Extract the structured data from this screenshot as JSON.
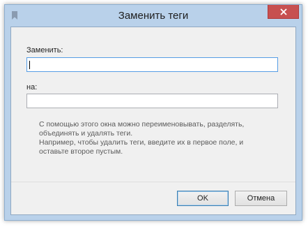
{
  "window": {
    "title": "Заменить теги",
    "close_symbol": "✕",
    "icon": "bookmark-icon"
  },
  "form": {
    "replace_label": "Заменить:",
    "replace_value": "",
    "with_label": "на:",
    "with_value": ""
  },
  "help": {
    "lines": [
      "С помощью этого окна можно переименовывать, разделять,",
      "объединять и удалять теги.",
      "Например, чтобы удалить теги, введите их в первое поле, и",
      "оставьте второе пустым."
    ]
  },
  "buttons": {
    "ok_label": "OK",
    "cancel_label": "Отмена"
  },
  "colors": {
    "frame": "#b9d1ea",
    "close": "#c75050",
    "focus_border": "#569de5"
  }
}
